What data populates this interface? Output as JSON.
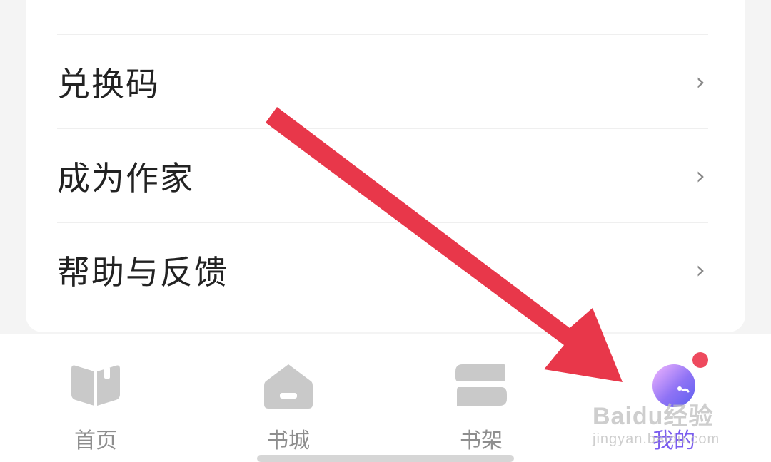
{
  "menu": {
    "partial_item": "",
    "items": [
      {
        "label": "兑换码",
        "chevron": "›"
      },
      {
        "label": "成为作家",
        "chevron": "›"
      },
      {
        "label": "帮助与反馈",
        "chevron": "›"
      }
    ]
  },
  "tabbar": {
    "tabs": [
      {
        "label": "首页",
        "icon": "book-open-icon",
        "active": false
      },
      {
        "label": "书城",
        "icon": "store-icon",
        "active": false
      },
      {
        "label": "书架",
        "icon": "bookshelf-icon",
        "active": false
      },
      {
        "label": "我的",
        "icon": "avatar-icon",
        "active": true
      }
    ]
  },
  "annotation": {
    "arrow_color": "#e8374a"
  },
  "watermark": {
    "main": "Baidu经验",
    "sub": "jingyan.baidu.com"
  },
  "colors": {
    "active_tab": "#7a5cf0",
    "inactive_tab": "#8e8e8e",
    "badge": "#ee4a5e"
  }
}
